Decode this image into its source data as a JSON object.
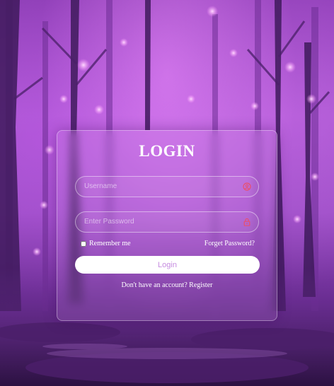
{
  "login": {
    "title": "LOGIN",
    "username_placeholder": "Username",
    "password_placeholder": "Enter Password",
    "remember_label": "Remember me",
    "forgot_label": "Forget Password?",
    "button_label": "Login",
    "no_account_text": "Don't have an account?",
    "register_label": "Register"
  },
  "icons": {
    "username": "user-icon",
    "password": "lock-icon"
  },
  "colors": {
    "icon_accent": "#e8506e",
    "button_text": "#c68ce0",
    "background_purple": "#9a4ec4"
  }
}
